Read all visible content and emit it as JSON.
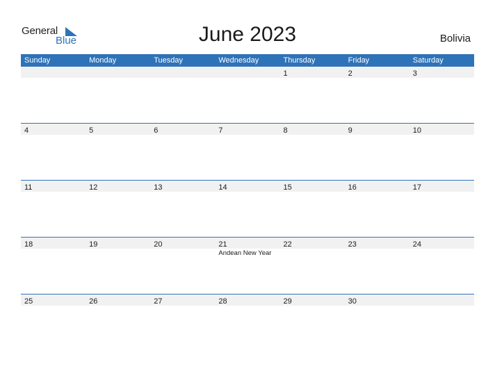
{
  "logo": {
    "text_general": "General",
    "text_blue": "Blue",
    "icon": "triangle-logo-icon",
    "accent": "#2e73b8"
  },
  "title": "June 2023",
  "country": "Bolivia",
  "colors": {
    "header_bg": "#2e73b8",
    "row_bg": "#f1f1f1"
  },
  "weekdays": [
    "Sunday",
    "Monday",
    "Tuesday",
    "Wednesday",
    "Thursday",
    "Friday",
    "Saturday"
  ],
  "weeks": [
    {
      "days": [
        "",
        "",
        "",
        "",
        "1",
        "2",
        "3"
      ],
      "events": [
        "",
        "",
        "",
        "",
        "",
        "",
        ""
      ]
    },
    {
      "days": [
        "4",
        "5",
        "6",
        "7",
        "8",
        "9",
        "10"
      ],
      "events": [
        "",
        "",
        "",
        "",
        "",
        "",
        ""
      ]
    },
    {
      "days": [
        "11",
        "12",
        "13",
        "14",
        "15",
        "16",
        "17"
      ],
      "events": [
        "",
        "",
        "",
        "",
        "",
        "",
        ""
      ]
    },
    {
      "days": [
        "18",
        "19",
        "20",
        "21",
        "22",
        "23",
        "24"
      ],
      "events": [
        "",
        "",
        "",
        "Andean New Year",
        "",
        "",
        ""
      ]
    },
    {
      "days": [
        "25",
        "26",
        "27",
        "28",
        "29",
        "30",
        ""
      ],
      "events": [
        "",
        "",
        "",
        "",
        "",
        "",
        ""
      ]
    }
  ]
}
